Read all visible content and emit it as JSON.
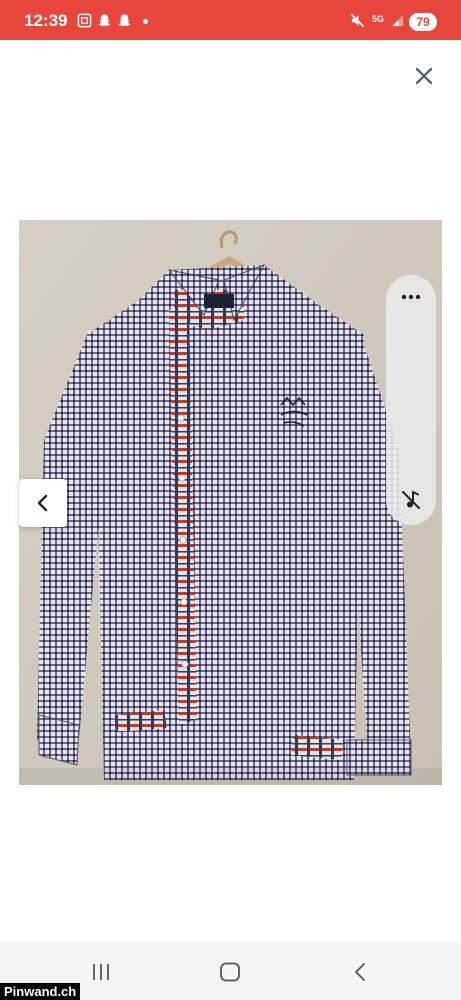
{
  "status_bar": {
    "time": "12:39",
    "network": "5G",
    "battery": "79",
    "icons": [
      "screenshot-icon",
      "snapchat-icon",
      "snapchat-icon",
      "mute-icon",
      "signal-icon"
    ]
  },
  "viewer": {
    "close_icon": "close-icon",
    "prev_icon": "chevron-left-icon",
    "more_icon": "more-horizontal-icon",
    "mute_icon": "music-off-icon",
    "image_subject": "checked button-down shirt on hanger"
  },
  "nav_bar": {
    "icons": [
      "recent-apps-icon",
      "home-icon",
      "back-icon"
    ]
  },
  "watermark": "Pinwand.ch",
  "colors": {
    "status_bar": "#e8463a",
    "background": "#ffffff",
    "nav_bar": "#f4f4f4"
  }
}
